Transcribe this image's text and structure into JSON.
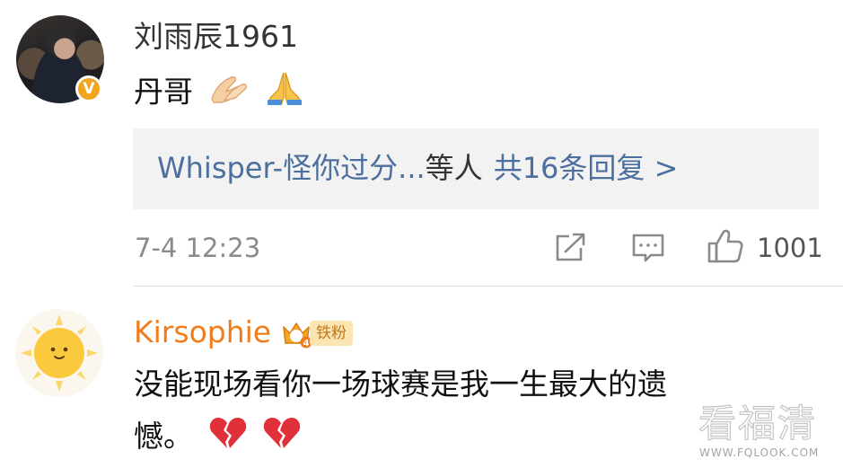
{
  "comments": [
    {
      "username": "刘雨辰1961",
      "verified_badge": "V",
      "text": "丹哥",
      "emojis": [
        "hands-pressed-icon",
        "praying-hands-icon"
      ],
      "replies": {
        "users": "Whisper-怪你过分...",
        "others_suffix": "等人",
        "count_label": "共16条回复 >"
      },
      "timestamp": "7-4 12:23",
      "like_count": "1001"
    },
    {
      "username": "Kirsophie",
      "fan_level": "4",
      "fan_label": "铁粉",
      "text_line1": "没能现场看你一场球赛是我一生最大的遗",
      "text_line2": "憾。",
      "emojis": [
        "broken-heart-icon",
        "broken-heart-icon"
      ]
    }
  ],
  "watermark": {
    "main": "看福清",
    "url": "WWW.FQLOOK.COM"
  },
  "colors": {
    "link_blue": "#4b6f9e",
    "username_orange": "#f07c1c",
    "verified_gold": "#f2a51c",
    "reply_box_bg": "#f2f2f2"
  }
}
